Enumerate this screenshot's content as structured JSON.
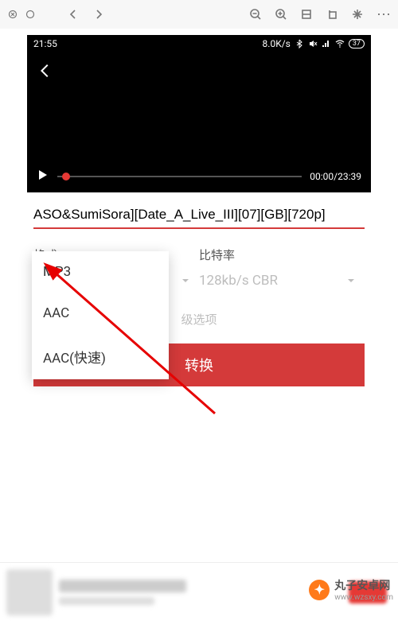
{
  "statusbar": {
    "time": "21:55",
    "net_speed": "8.0K/s",
    "battery": "37"
  },
  "video": {
    "time_display": "00:00/23:39"
  },
  "form": {
    "title_value": "ASO&SumiSora][Date_A_Live_III][07][GB][720p]",
    "format_label": "格式",
    "bitrate_label": "比特率",
    "bitrate_value": "128kb/s CBR",
    "advanced_label": "级选项",
    "convert_label": "转换"
  },
  "dropdown": {
    "items": [
      {
        "label": "MP3"
      },
      {
        "label": "AAC"
      },
      {
        "label": "AAC(快速)"
      }
    ]
  },
  "watermark": {
    "site_name": "丸子安卓网",
    "url": "www.wzsxy.com"
  }
}
